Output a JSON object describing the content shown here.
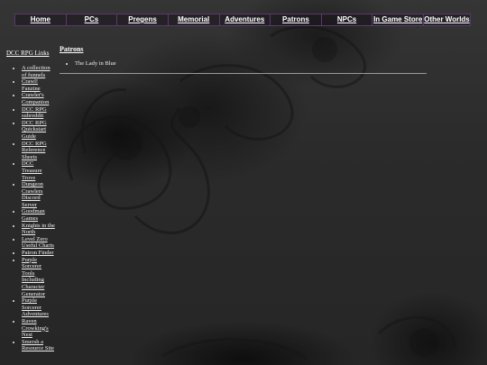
{
  "nav": {
    "items": [
      {
        "label": "Home"
      },
      {
        "label": "PCs"
      },
      {
        "label": "Pregens"
      },
      {
        "label": "Memorial"
      },
      {
        "label": "Adventures"
      },
      {
        "label": "Patrons"
      },
      {
        "label": "NPCs"
      },
      {
        "label": "In Game Store"
      },
      {
        "label": "Other Worlds"
      }
    ]
  },
  "sidebar": {
    "title": "DCC RPG Links",
    "links": [
      {
        "label": "A collection of funnels"
      },
      {
        "label": "Crawl! Fanzine"
      },
      {
        "label": "Crawler's Companion"
      },
      {
        "label": "DCC RPG subreddit"
      },
      {
        "label": "DCC RPG Quickstart Guide"
      },
      {
        "label": "DCC RPG Reference Sheets"
      },
      {
        "label": "DCC Treasure Trove"
      },
      {
        "label": "Dungeon Crawlers Discord Server"
      },
      {
        "label": "Goodman Games"
      },
      {
        "label": "Knights in the North"
      },
      {
        "label": "Level Zero Useful Charts"
      },
      {
        "label": "Patron Finder"
      },
      {
        "label": "Purple Sorcerer Tools Including Character Generator"
      },
      {
        "label": "Purple Sorcerer Adventures"
      },
      {
        "label": "Raven Crowking's Nest"
      },
      {
        "label": "Smersh a Resource Site"
      }
    ]
  },
  "main": {
    "heading": "Patrons",
    "items": [
      {
        "label": "The Lady in Blue"
      }
    ]
  }
}
